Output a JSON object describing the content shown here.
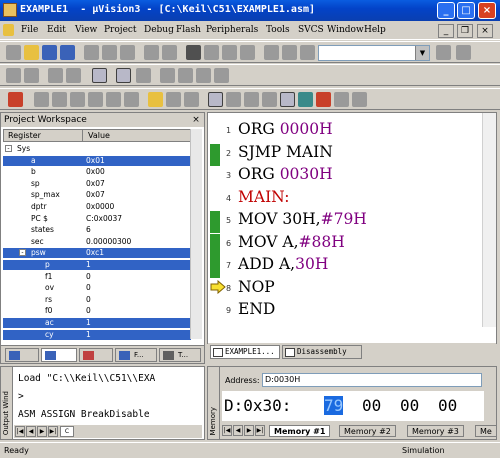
{
  "window": {
    "title": "EXAMPLE1  - μVision3 - [C:\\Keil\\C51\\EXAMPLE1.asm]",
    "controls": [
      "_",
      "□",
      "×"
    ]
  },
  "menu": {
    "items": [
      "File",
      "Edit",
      "View",
      "Project",
      "Debug",
      "Flash",
      "Peripherals",
      "Tools",
      "SVCS",
      "Window",
      "Help"
    ],
    "mdi_controls": [
      "_",
      "❐",
      "×"
    ]
  },
  "toolbar": {
    "find_combo_value": ""
  },
  "workspace": {
    "title": "Project Workspace",
    "close": "×",
    "columns": [
      "Register",
      "Value"
    ],
    "rows": [
      {
        "name": "Sys",
        "value": "",
        "indent": 0,
        "expand": "-",
        "selected": false
      },
      {
        "name": "a",
        "value": "0x01",
        "indent": 1,
        "expand": "",
        "selected": true
      },
      {
        "name": "b",
        "value": "0x00",
        "indent": 1,
        "expand": "",
        "selected": false
      },
      {
        "name": "sp",
        "value": "0x07",
        "indent": 1,
        "expand": "",
        "selected": false
      },
      {
        "name": "sp_max",
        "value": "0x07",
        "indent": 1,
        "expand": "",
        "selected": false
      },
      {
        "name": "dptr",
        "value": "0x0000",
        "indent": 1,
        "expand": "",
        "selected": false
      },
      {
        "name": "PC  $",
        "value": "C:0x0037",
        "indent": 1,
        "expand": "",
        "selected": false
      },
      {
        "name": "states",
        "value": "6",
        "indent": 1,
        "expand": "",
        "selected": false
      },
      {
        "name": "sec",
        "value": "0.00000300",
        "indent": 1,
        "expand": "",
        "selected": false
      },
      {
        "name": "psw",
        "value": "0xc1",
        "indent": 1,
        "expand": "-",
        "selected": true
      },
      {
        "name": "p",
        "value": "1",
        "indent": 2,
        "expand": "",
        "selected": true
      },
      {
        "name": "f1",
        "value": "0",
        "indent": 2,
        "expand": "",
        "selected": false
      },
      {
        "name": "ov",
        "value": "0",
        "indent": 2,
        "expand": "",
        "selected": false
      },
      {
        "name": "rs",
        "value": "0",
        "indent": 2,
        "expand": "",
        "selected": false
      },
      {
        "name": "f0",
        "value": "0",
        "indent": 2,
        "expand": "",
        "selected": false
      },
      {
        "name": "ac",
        "value": "1",
        "indent": 2,
        "expand": "",
        "selected": true
      },
      {
        "name": "cy",
        "value": "1",
        "indent": 2,
        "expand": "",
        "selected": true
      }
    ],
    "tabs": [
      "",
      "",
      "",
      "F...",
      "T..."
    ]
  },
  "editor": {
    "lines": [
      {
        "num": "1",
        "parts": [
          [
            "kw",
            "ORG "
          ],
          [
            "num",
            "0000H"
          ]
        ],
        "green": false
      },
      {
        "num": "2",
        "parts": [
          [
            "kw",
            "SJMP MAIN"
          ]
        ],
        "green": true
      },
      {
        "num": "3",
        "parts": [
          [
            "kw",
            "ORG "
          ],
          [
            "num",
            "0030H"
          ]
        ],
        "green": false
      },
      {
        "num": "4",
        "parts": [
          [
            "lbl",
            "MAIN:"
          ]
        ],
        "green": false
      },
      {
        "num": "5",
        "parts": [
          [
            "kw",
            "MOV 30H,"
          ],
          [
            "num",
            "#79H"
          ]
        ],
        "green": true
      },
      {
        "num": "6",
        "parts": [
          [
            "kw",
            "MOV A,"
          ],
          [
            "num",
            "#88H"
          ]
        ],
        "green": true
      },
      {
        "num": "7",
        "parts": [
          [
            "kw",
            "ADD A,"
          ],
          [
            "num",
            "30H"
          ]
        ],
        "green": true
      },
      {
        "num": "8",
        "parts": [
          [
            "kw",
            "NOP"
          ]
        ],
        "green": false
      },
      {
        "num": "9",
        "parts": [
          [
            "kw",
            "END"
          ]
        ],
        "green": false
      }
    ],
    "current_line": 8,
    "tabs": [
      "EXAMPLE1...",
      "Disassembly"
    ]
  },
  "output": {
    "side_label": "Output Wind",
    "lines": [
      "Load \"C:\\\\Keil\\\\C51\\\\EXA",
      ">",
      "ASM ASSIGN BreakDisable"
    ],
    "tab_label": "C"
  },
  "memory": {
    "side_label": "Memory",
    "address_label": "Address:",
    "address_value": "D:0030H",
    "row_addr": "D:0x30:",
    "bytes": [
      "79",
      "00",
      "00",
      "00"
    ],
    "highlight_index": 0,
    "tabs": [
      "Memory #1",
      "Memory #2",
      "Memory #3",
      "Me"
    ]
  },
  "status": {
    "left": "Ready",
    "right": "Simulation"
  }
}
